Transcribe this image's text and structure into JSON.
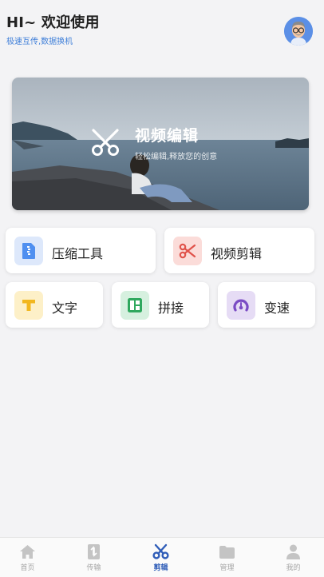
{
  "header": {
    "greeting": "HI~ 欢迎使用",
    "subtitle": "极速互传,数据换机"
  },
  "banner": {
    "title": "视频编辑",
    "subtitle": "轻松编辑,释放您的创意",
    "icon": "scissors-icon"
  },
  "tools": [
    {
      "label": "压缩工具",
      "icon": "zip-file-icon",
      "color": "#4f8ff0",
      "bg": "#dde8fb"
    },
    {
      "label": "视频剪辑",
      "icon": "scissors-icon",
      "color": "#e0524a",
      "bg": "#fbdcd9"
    },
    {
      "label": "文字",
      "icon": "text-t-icon",
      "color": "#f2b71f",
      "bg": "#fdf0c8"
    },
    {
      "label": "拼接",
      "icon": "layout-icon",
      "color": "#2fa85e",
      "bg": "#d6f0df"
    },
    {
      "label": "变速",
      "icon": "speed-gauge-icon",
      "color": "#7a4bc4",
      "bg": "#e6dcf5"
    }
  ],
  "tabbar": {
    "items": [
      {
        "label": "首页",
        "icon": "home-icon"
      },
      {
        "label": "传输",
        "icon": "transfer-icon"
      },
      {
        "label": "剪辑",
        "icon": "scissors-icon",
        "active": true
      },
      {
        "label": "管理",
        "icon": "folder-icon"
      },
      {
        "label": "我的",
        "icon": "user-icon"
      }
    ],
    "active_color": "#2f5db8",
    "inactive_color": "#b5b5b5"
  }
}
